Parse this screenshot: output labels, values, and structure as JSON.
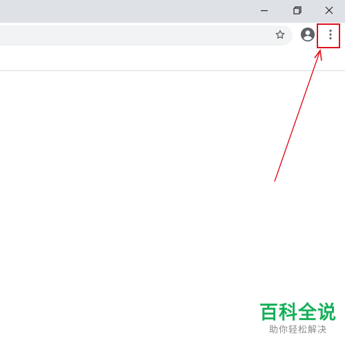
{
  "window_controls": {
    "minimize_icon": "minimize-icon",
    "restore_icon": "restore-icon",
    "close_icon": "close-icon"
  },
  "toolbar": {
    "address_value": "",
    "bookmark_icon": "star-icon",
    "profile_icon": "account-circle-icon",
    "menu_icon": "more-vert-icon"
  },
  "annotation": {
    "highlight_color": "#e0101e",
    "target": "menu-button"
  },
  "watermark": {
    "title": "百科全说",
    "subtitle": "助你轻松解决",
    "title_color": "#18b05a"
  }
}
